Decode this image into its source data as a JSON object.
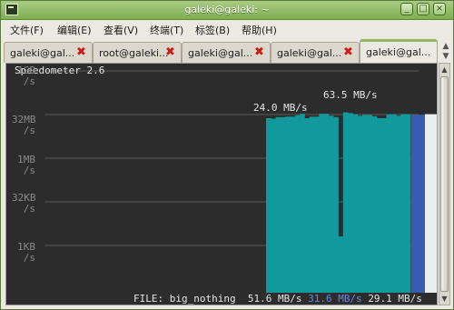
{
  "window": {
    "title": "galeki@galeki: ~"
  },
  "menu": [
    "文件(F)",
    "编辑(E)",
    "查看(V)",
    "终端(T)",
    "标签(B)",
    "帮助(H)"
  ],
  "tabs": [
    {
      "label": "galeki@gal..."
    },
    {
      "label": "root@galeki..."
    },
    {
      "label": "galeki@gal..."
    },
    {
      "label": "galeki@gal..."
    },
    {
      "label": "galeki@gal..."
    }
  ],
  "terminal": {
    "app_title": "Speedometer 2.6",
    "y_labels": [
      {
        "top": "1GB",
        "bottom": "/s"
      },
      {
        "top": "32MB",
        "bottom": "/s"
      },
      {
        "top": "1MB",
        "bottom": "/s"
      },
      {
        "top": "32KB",
        "bottom": "/s"
      },
      {
        "top": "1KB",
        "bottom": "/s"
      }
    ],
    "annotation_low": "24.0 MB/s",
    "annotation_high": "63.5 MB/s",
    "status_prefix": "FILE: big_nothing",
    "avg_rate": "51.6 MB/s",
    "current_rate": "31.6 MB/s",
    "min_rate": "29.1 MB/s",
    "colors": {
      "bar": "#11999d",
      "current": "#3a5bb0",
      "ghost": "#e9efee",
      "background": "#2c2c2c"
    }
  },
  "chart_data": {
    "type": "bar",
    "title": "Speedometer 2.6",
    "scale": "log",
    "y_ticks": [
      "1GB/s",
      "32MB/s",
      "1MB/s",
      "32KB/s",
      "1KB/s"
    ],
    "series": [
      {
        "name": "FILE: big_nothing",
        "values": [
          24,
          23,
          26,
          26,
          27,
          27,
          30,
          34,
          24,
          27,
          27,
          34,
          34,
          29,
          26,
          0.002,
          38,
          36,
          33,
          29,
          31,
          31,
          28,
          24,
          24,
          33,
          33,
          29,
          33,
          33,
          31.6
        ]
      }
    ],
    "annotations": [
      "24.0 MB/s",
      "63.5 MB/s"
    ]
  }
}
